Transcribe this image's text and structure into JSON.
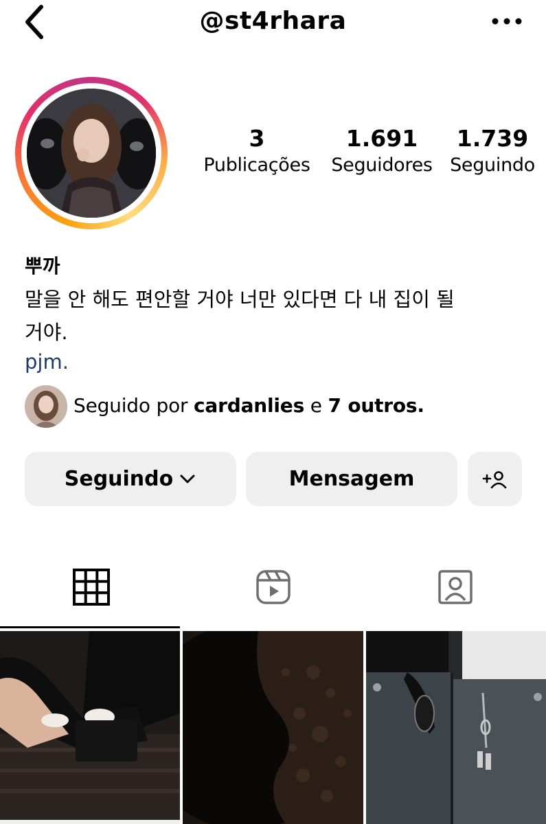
{
  "header": {
    "username": "@st4rhara",
    "back_icon": "chevron-left-icon",
    "more_icon": "more-horizontal-icon"
  },
  "profile": {
    "stats": [
      {
        "value": "3",
        "label": "Publicações"
      },
      {
        "value": "1.691",
        "label": "Seguidores"
      },
      {
        "value": "1.739",
        "label": "Seguindo"
      }
    ],
    "display_name": "뿌까",
    "bio_line1": "말을 안 해도 편안할 거야 너만 있다면 다 내 집이 될",
    "bio_line2": "거야.",
    "link": "pjm.",
    "followed_by": {
      "prefix": "Seguido por",
      "user": "cardanlies",
      "conjunction": "e",
      "others": "7 outros."
    }
  },
  "actions": {
    "following_label": "Seguindo",
    "message_label": "Mensagem",
    "add_user_icon": "add-person-icon"
  },
  "tabs": [
    {
      "name": "grid",
      "icon": "grid-icon",
      "active": true
    },
    {
      "name": "reels",
      "icon": "reels-icon",
      "active": false
    },
    {
      "name": "tagged",
      "icon": "tagged-person-icon",
      "active": false
    }
  ],
  "colors": {
    "link": "#1e3a6e",
    "button_bg": "#efefef",
    "story_ring": [
      "#f9a10a",
      "#e1306c",
      "#c13584"
    ]
  }
}
